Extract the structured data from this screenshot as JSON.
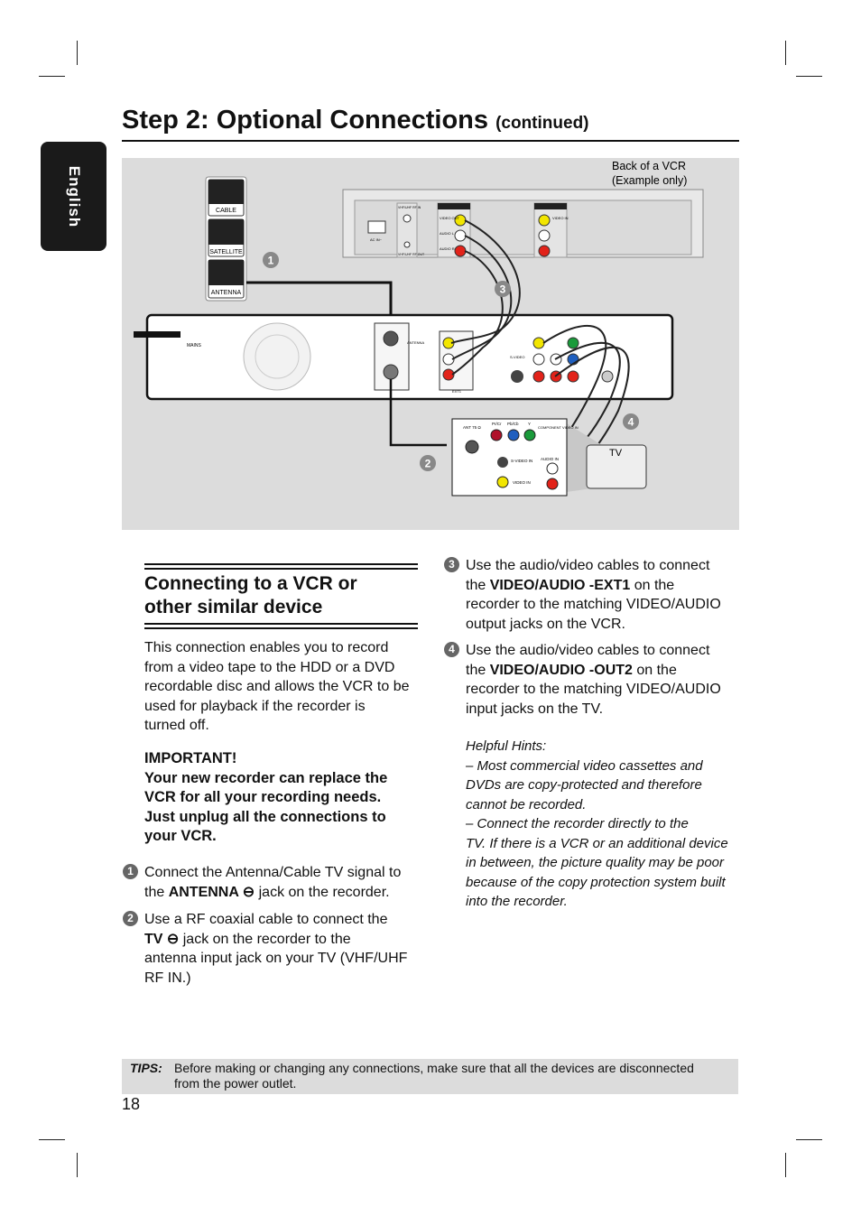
{
  "language_tab": "English",
  "title": {
    "main": "Step 2: Optional Connections",
    "suffix": "(continued)"
  },
  "diagram": {
    "vcr_caption": [
      "Back of a VCR",
      "(Example only)"
    ],
    "sources": [
      "CABLE",
      "SATELLITE",
      "ANTENNA"
    ],
    "vcr_labels": {
      "ac_in": "AC IN~",
      "rf_in": "VHF/UHF RF IN",
      "rf_out": "VHF/UHF RF OUT",
      "video_out": "VIDEO OUT",
      "audio_l": "AUDIO L",
      "audio_r": "AUDIO R",
      "video_in": "VIDEO IN"
    },
    "recorder_labels": {
      "mains": "MAINS",
      "antenna": "ANTENNA",
      "ext1": "EXT1",
      "svideo": "S-VIDEO"
    },
    "tv_labels": {
      "ant": "ANT 75 Ω",
      "pr": "Pr/Cr",
      "pb": "Pb/Cb",
      "y": "Y",
      "component": "COMPONENT VIDEO IN",
      "svideo": "S-VIDEO IN",
      "audio": "AUDIO IN",
      "video": "VIDEO IN",
      "tv": "TV"
    },
    "steps": [
      "1",
      "2",
      "3",
      "4"
    ],
    "colors": {
      "yellow": "#f2e600",
      "red": "#e2231a",
      "white": "#ffffff",
      "green": "#1a9a3a",
      "blue": "#1f5fbf"
    }
  },
  "section": {
    "heading": [
      "Connecting to a VCR or",
      "other similar device"
    ],
    "intro": [
      "This connection enables you to record",
      "from a video tape to the HDD or a DVD",
      "recordable disc and allows the VCR to be",
      "used for playback if the recorder is",
      "turned off."
    ],
    "important_label": "IMPORTANT!",
    "important": [
      "Your new recorder can replace the",
      "VCR for all your recording needs.",
      "Just unplug all the connections to",
      "your VCR."
    ],
    "steps": [
      {
        "num": "1",
        "lines": [
          "Connect the Antenna/Cable TV signal to",
          "the |ANTENNA ⊖| jack on the recorder."
        ]
      },
      {
        "num": "2",
        "lines": [
          "Use a RF coaxial cable to connect the",
          "|TV ⊖| jack on the recorder to the",
          "antenna input jack on your TV (VHF/UHF",
          "RF IN.)"
        ]
      },
      {
        "num": "3",
        "lines": [
          "Use the audio/video cables to connect",
          "the |VIDEO/AUDIO -EXT1| on the",
          "recorder to the matching VIDEO/AUDIO",
          "output jacks on the VCR."
        ]
      },
      {
        "num": "4",
        "lines": [
          "Use the audio/video cables to connect",
          "the |VIDEO/AUDIO -OUT2| on the",
          "recorder to the matching VIDEO/AUDIO",
          "input jacks on the TV."
        ]
      }
    ],
    "hints_title": "Helpful Hints:",
    "hints": [
      "– Most commercial video cassettes and",
      "DVDs are copy-protected and therefore",
      "cannot be recorded.",
      "– Connect the recorder directly to the",
      "TV. If there is a VCR or an additional device",
      "in between, the picture quality may be poor",
      "because of the copy protection system built",
      "into the recorder."
    ]
  },
  "tips": {
    "label": "TIPS:",
    "lines": [
      "Before making or changing any connections, make sure that all the devices are disconnected",
      "from the power outlet."
    ]
  },
  "page_number": "18"
}
